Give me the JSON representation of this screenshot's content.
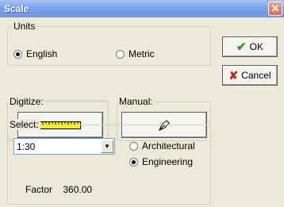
{
  "window": {
    "title": "Scale",
    "close_glyph": "✕"
  },
  "units": {
    "legend": "Units",
    "options": [
      {
        "label": "English",
        "checked": true
      },
      {
        "label": "Metric",
        "checked": false
      }
    ]
  },
  "digitize": {
    "legend": "Digitize:",
    "icon": "ruler-icon"
  },
  "manual": {
    "legend": "Manual:",
    "icon": "pen-nib-icon"
  },
  "buttons": {
    "ok_label": "OK",
    "cancel_label": "Cancel",
    "ok_glyph": "✔",
    "cancel_glyph": "✘"
  },
  "select_group": {
    "legend": "Select:",
    "scale_value": "1:30",
    "options": [
      {
        "label": "Architectural",
        "checked": false
      },
      {
        "label": "Engineering",
        "checked": true
      }
    ],
    "factor_label": "Factor",
    "factor_value": "360.00"
  },
  "colors": {
    "title_bar": "#7aa2ec",
    "ok_check": "#2a9a2a",
    "cancel_x": "#c62020",
    "ruler": "#f6ef2a"
  }
}
